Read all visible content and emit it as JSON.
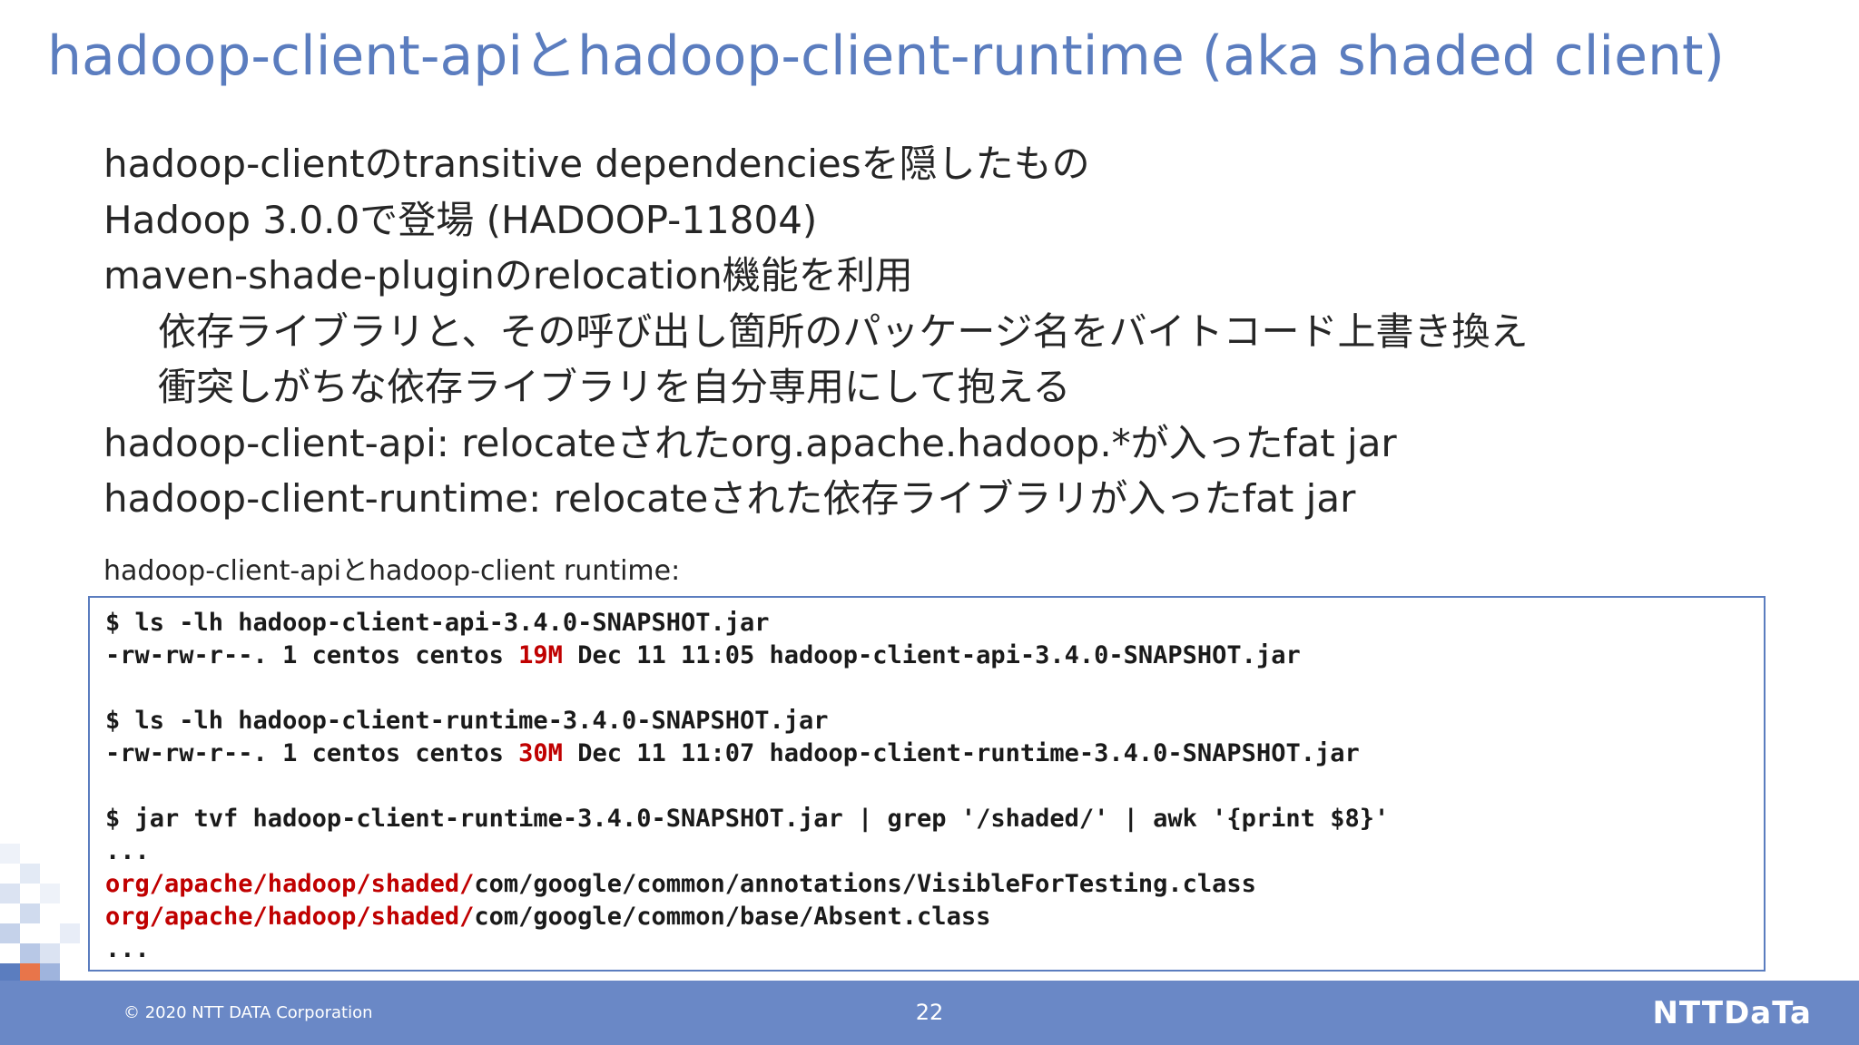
{
  "title": "hadoop-client-apiとhadoop-client-runtime (aka shaded client)",
  "bullets": [
    {
      "text": "hadoop-clientのtransitive dependenciesを隠したもの",
      "level": 1
    },
    {
      "text": "Hadoop 3.0.0で登場 (HADOOP-11804)",
      "level": 1
    },
    {
      "text": "maven-shade-pluginのrelocation機能を利用",
      "level": 1
    },
    {
      "text": "依存ライブラリと、その呼び出し箇所のパッケージ名をバイトコード上書き換え",
      "level": 2
    },
    {
      "text": "衝突しがちな依存ライブラリを自分専用にして抱える",
      "level": 2
    },
    {
      "text": "hadoop-client-api: relocateされたorg.apache.hadoop.*が入ったfat jar",
      "level": 1
    },
    {
      "text": "hadoop-client-runtime: relocateされた依存ライブラリが入ったfat jar",
      "level": 1
    }
  ],
  "code_caption": "hadoop-client-apiとhadoop-client runtime:",
  "code": {
    "line1": "$ ls -lh hadoop-client-api-3.4.0-SNAPSHOT.jar",
    "line2_pre": "-rw-rw-r--. 1 centos centos ",
    "line2_size": "19M",
    "line2_post": " Dec 11 11:05 hadoop-client-api-3.4.0-SNAPSHOT.jar",
    "line3": "$ ls -lh hadoop-client-runtime-3.4.0-SNAPSHOT.jar",
    "line4_pre": "-rw-rw-r--. 1 centos centos ",
    "line4_size": "30M",
    "line4_post": " Dec 11 11:07 hadoop-client-runtime-3.4.0-SNAPSHOT.jar",
    "line5": "$ jar tvf hadoop-client-runtime-3.4.0-SNAPSHOT.jar | grep '/shaded/' | awk '{print $8}'",
    "ellipsis1": "...",
    "line6_prefix": "org/apache/hadoop/shaded/",
    "line6_rest": "com/google/common/annotations/VisibleForTesting.class",
    "line7_prefix": "org/apache/hadoop/shaded/",
    "line7_rest": "com/google/common/base/Absent.class",
    "ellipsis2": "..."
  },
  "footer": {
    "copyright": "© 2020 NTT DATA Corporation",
    "page_number": "22",
    "logo": "NTTDaTa"
  },
  "colors": {
    "title": "#5b7dbf",
    "footer": "#6a88c6",
    "highlight": "#c00000",
    "code_border": "#5b7dbf"
  }
}
